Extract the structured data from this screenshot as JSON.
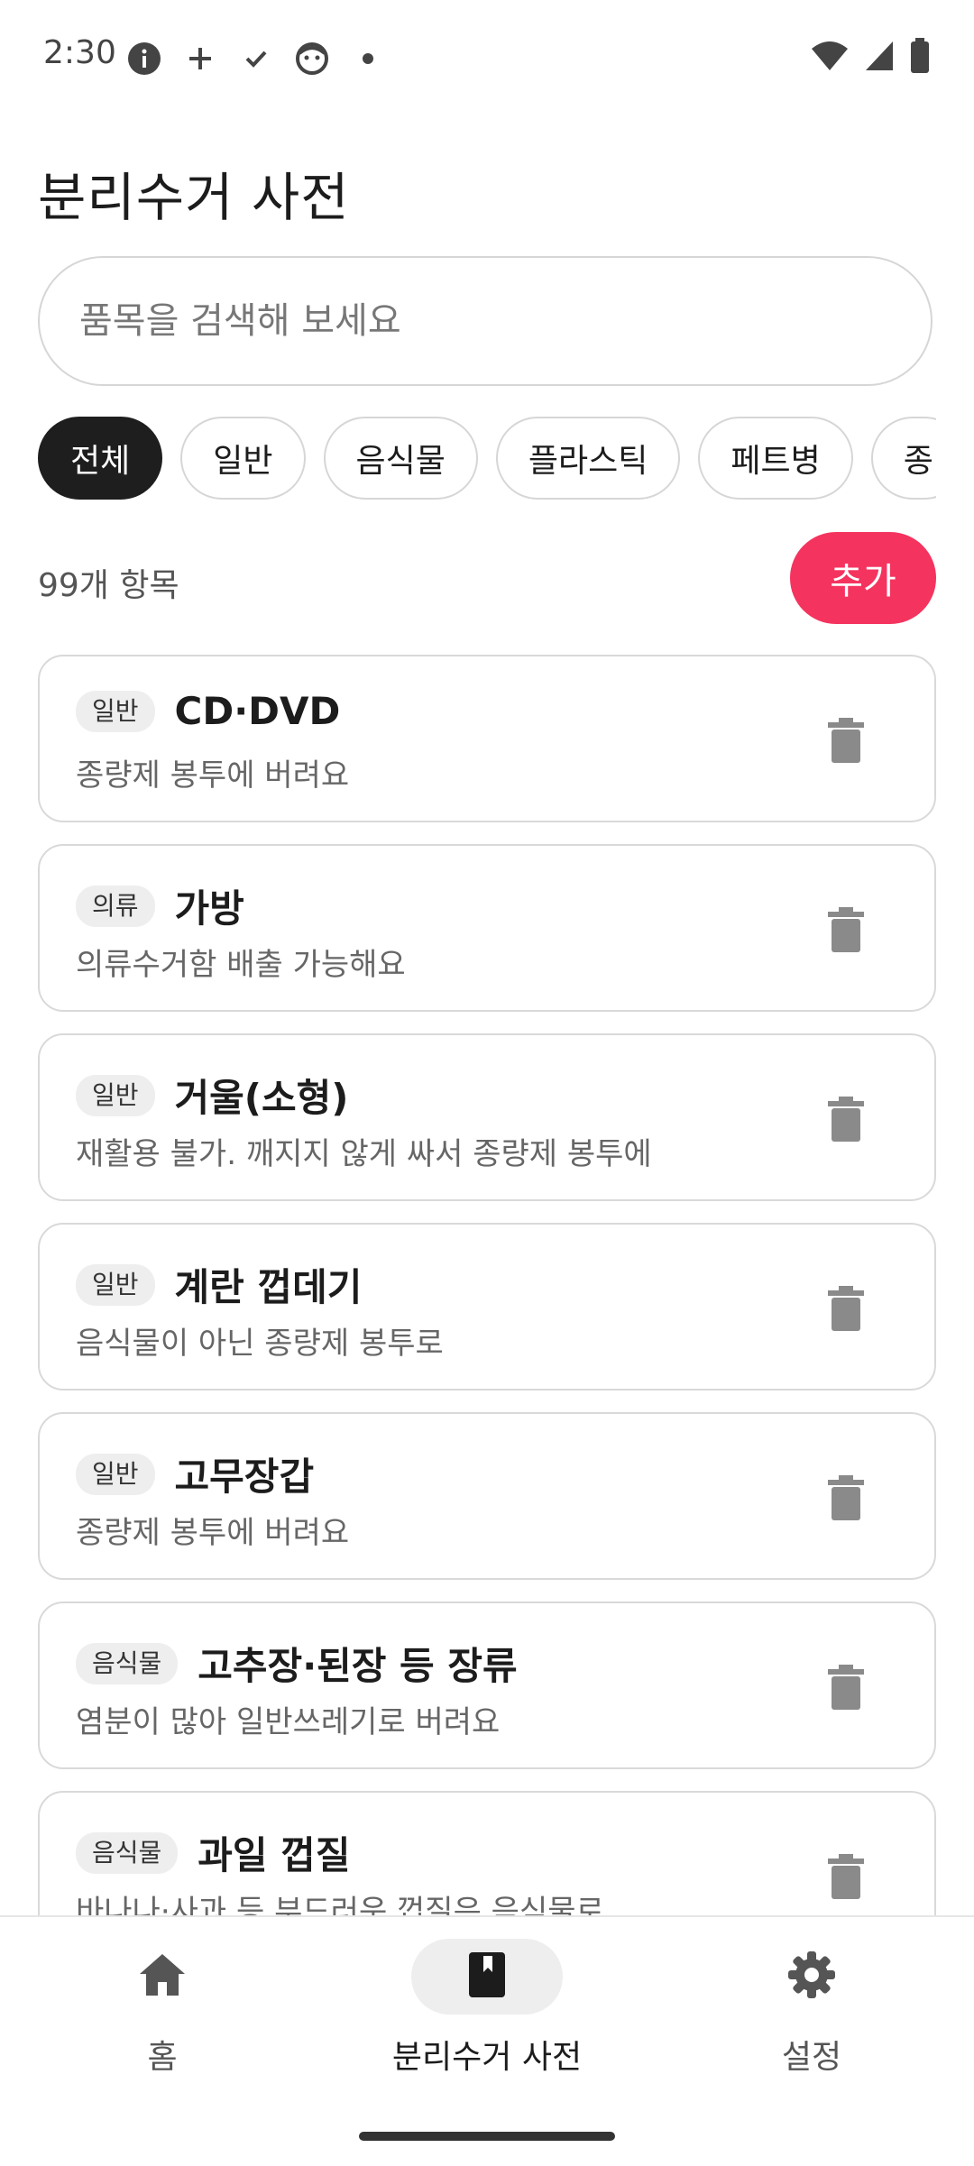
{
  "status_bar": {
    "time": "2:30",
    "icons": [
      "info-icon",
      "plus-icon",
      "check-icon",
      "face-icon",
      "dot-icon"
    ],
    "right_icons": [
      "wifi-icon",
      "signal-icon",
      "battery-icon"
    ]
  },
  "header": {
    "title": "분리수거 사전"
  },
  "search": {
    "placeholder": "품목을 검색해 보세요",
    "value": ""
  },
  "chips": [
    {
      "label": "전체",
      "active": true
    },
    {
      "label": "일반",
      "active": false
    },
    {
      "label": "음식물",
      "active": false
    },
    {
      "label": "플라스틱",
      "active": false
    },
    {
      "label": "페트병",
      "active": false
    },
    {
      "label": "종",
      "active": false
    }
  ],
  "summary": {
    "count_text": "99개 항목",
    "add_label": "추가"
  },
  "items": [
    {
      "category": "일반",
      "name": "CD·DVD",
      "description": "종량제 봉투에 버려요"
    },
    {
      "category": "의류",
      "name": "가방",
      "description": "의류수거함 배출 가능해요"
    },
    {
      "category": "일반",
      "name": "거울(소형)",
      "description": "재활용 불가. 깨지지 않게 싸서 종량제 봉투에"
    },
    {
      "category": "일반",
      "name": "계란 껍데기",
      "description": "음식물이 아닌 종량제 봉투로"
    },
    {
      "category": "일반",
      "name": "고무장갑",
      "description": "종량제 봉투에 버려요"
    },
    {
      "category": "음식물",
      "name": "고추장·된장 등 장류",
      "description": "염분이 많아 일반쓰레기로 버려요"
    },
    {
      "category": "음식물",
      "name": "과일 껍질",
      "description": "바나나·사과 등 부드러운 껍질은 음식물로"
    }
  ],
  "bottom_nav": [
    {
      "label": "홈",
      "icon": "home-icon",
      "active": false
    },
    {
      "label": "분리수거 사전",
      "icon": "book-icon",
      "active": true
    },
    {
      "label": "설정",
      "icon": "gear-icon",
      "active": false
    }
  ],
  "colors": {
    "accent": "#f5335f",
    "chip_active": "#1e1e1e",
    "border": "#d9d9d9"
  }
}
